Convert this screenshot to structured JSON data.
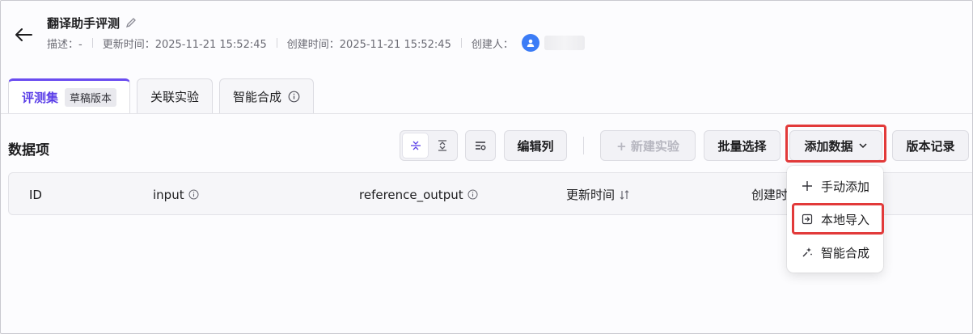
{
  "header": {
    "title": "翻译助手评测",
    "description": "描述：-",
    "updated": "更新时间：2025-11-21 15:52:45",
    "created": "创建时间：2025-11-21 15:52:45",
    "creator_label": "创建人："
  },
  "tabs": [
    {
      "label": "评测集",
      "badge": "草稿版本",
      "active": true
    },
    {
      "label": "关联实验"
    },
    {
      "label": "智能合成"
    }
  ],
  "section": {
    "title": "数据项"
  },
  "toolbar": {
    "edit_columns": "编辑列",
    "new_experiment": "+ 新建实验",
    "batch_select": "批量选择",
    "add_data": "添加数据",
    "version_history": "版本记录"
  },
  "table": {
    "columns": [
      "ID",
      "input",
      "reference_output",
      "更新时间",
      "创建时"
    ]
  },
  "dropdown": {
    "items": [
      "手动添加",
      "本地导入",
      "智能合成"
    ]
  },
  "colors": {
    "accent": "#5b3fe8",
    "highlight": "#e23a3a",
    "avatar": "#3b7cf6"
  }
}
